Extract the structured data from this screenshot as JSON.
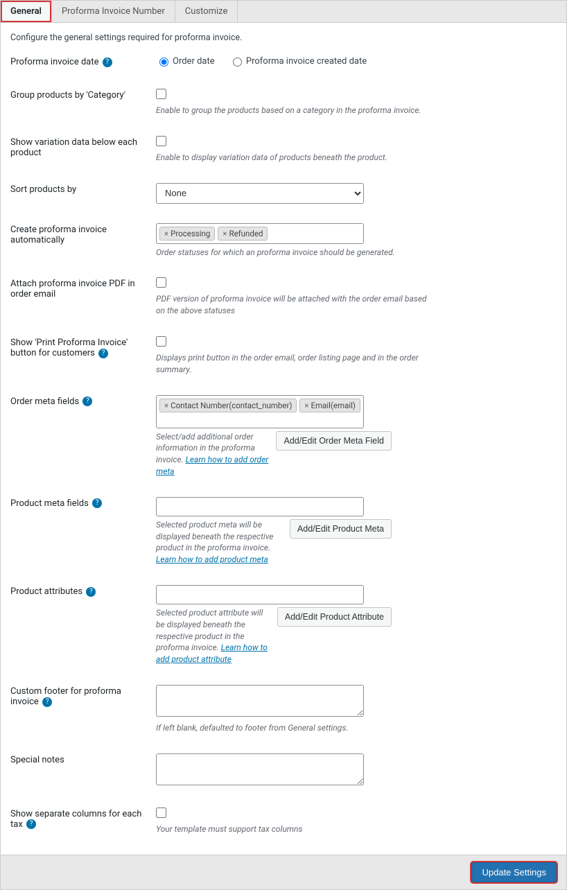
{
  "tabs": {
    "general": "General",
    "number": "Proforma Invoice Number",
    "customize": "Customize"
  },
  "intro": "Configure the general settings required for proforma invoice.",
  "rows": {
    "date": {
      "label": "Proforma invoice date",
      "opt_order": "Order date",
      "opt_created": "Proforma invoice created date"
    },
    "group": {
      "label": "Group products by 'Category'",
      "desc": "Enable to group the products based on a category in the proforma invoice."
    },
    "variation": {
      "label": "Show variation data below each product",
      "desc": "Enable to display variation data of products beneath the product."
    },
    "sort": {
      "label": "Sort products by",
      "selected": "None"
    },
    "auto": {
      "label": "Create proforma invoice automatically",
      "desc": "Order statuses for which an proforma invoice should be generated.",
      "tags": [
        "Processing",
        "Refunded"
      ]
    },
    "attach": {
      "label": "Attach proforma invoice PDF in order email",
      "desc": "PDF version of proforma invoice will be attached with the order email based on the above statuses"
    },
    "printbtn": {
      "label": "Show 'Print Proforma Invoice' button for customers",
      "desc": "Displays print button in the order email, order listing page and in the order summary."
    },
    "ordermeta": {
      "label": "Order meta fields",
      "tags": [
        "Contact Number(contact_number)",
        "Email(email)"
      ],
      "desc": "Select/add additional order information in the proforma invoice.",
      "link": "Learn how to add order meta",
      "button": "Add/Edit Order Meta Field"
    },
    "productmeta": {
      "label": "Product meta fields",
      "desc": "Selected product meta will be displayed beneath the respective product in the proforma invoice.",
      "link": "Learn how to add product meta",
      "button": "Add/Edit Product Meta"
    },
    "productattr": {
      "label": "Product attributes",
      "desc": "Selected product attribute will be displayed beneath the respective product in the proforma invoice.",
      "link": "Learn how to add product attribute",
      "button": "Add/Edit Product Attribute"
    },
    "footer": {
      "label": "Custom footer for proforma invoice",
      "desc": "If left blank, defaulted to footer from General settings."
    },
    "notes": {
      "label": "Special notes"
    },
    "taxcols": {
      "label": "Show separate columns for each tax",
      "desc": "Your template must support tax columns"
    }
  },
  "update_button": "Update Settings"
}
